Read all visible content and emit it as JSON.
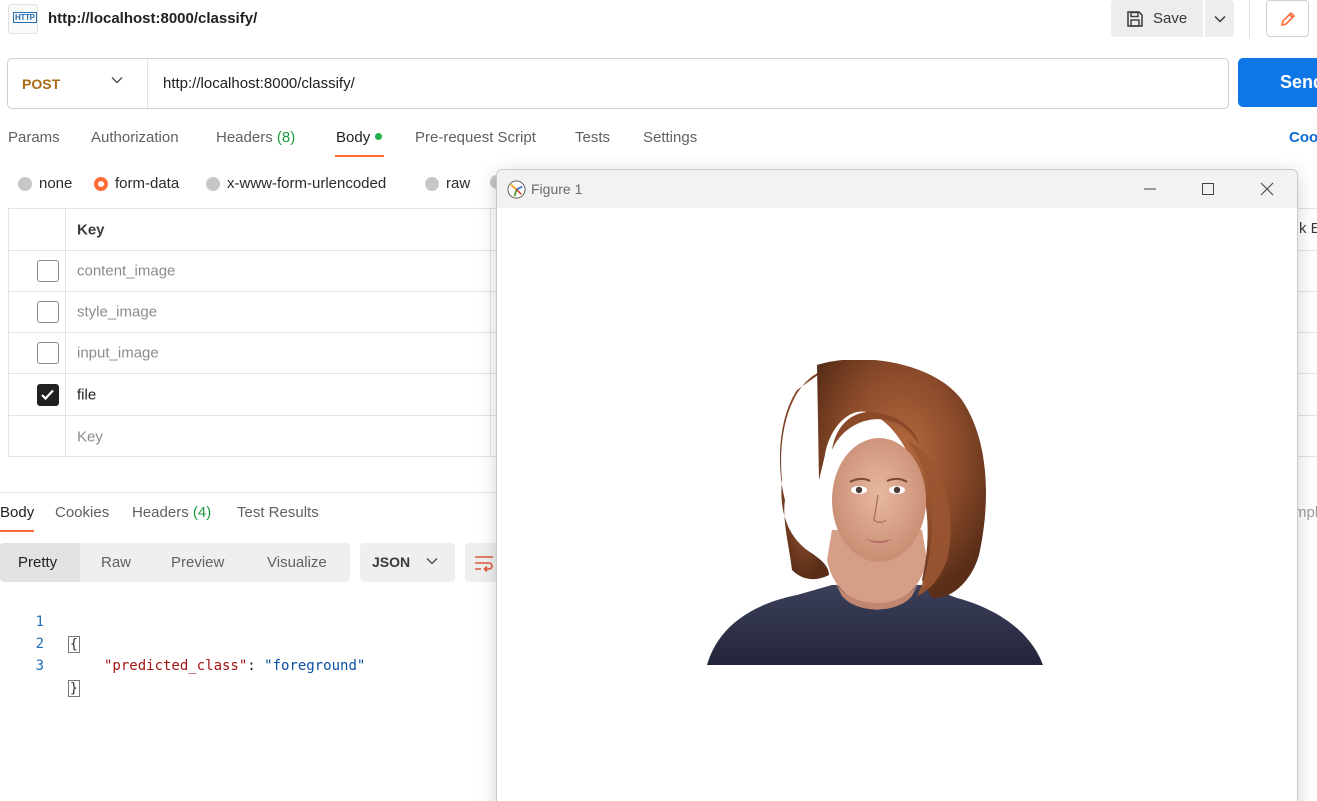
{
  "top_bar": {
    "icon_label": "HTTP",
    "title": "http://localhost:8000/classify/",
    "save_label": "Save"
  },
  "request": {
    "method": "POST",
    "url": "http://localhost:8000/classify/",
    "send_label": "Send"
  },
  "request_tabs": {
    "params": "Params",
    "authorization": "Authorization",
    "headers": "Headers",
    "headers_count": "(8)",
    "body": "Body",
    "pre_request": "Pre-request Script",
    "tests": "Tests",
    "settings": "Settings",
    "cookies": "Coo"
  },
  "body_types": {
    "none": "none",
    "form_data": "form-data",
    "urlencoded": "x-www-form-urlencoded",
    "raw": "raw",
    "selected": "form-data"
  },
  "form_table": {
    "key_header": "Key",
    "rows": [
      {
        "key": "content_image",
        "checked": false
      },
      {
        "key": "style_image",
        "checked": false
      },
      {
        "key": "input_image",
        "checked": false
      },
      {
        "key": "file",
        "checked": true
      }
    ],
    "new_key_placeholder": "Key",
    "right_header_partial": "k E"
  },
  "response_tabs": {
    "body": "Body",
    "cookies": "Cookies",
    "headers": "Headers",
    "headers_count": "(4)",
    "test_results": "Test Results",
    "right_partial": "mpl"
  },
  "view_toolbar": {
    "pretty": "Pretty",
    "raw": "Raw",
    "preview": "Preview",
    "visualize": "Visualize",
    "format": "JSON"
  },
  "response_body": {
    "line_numbers": [
      "1",
      "2",
      "3"
    ],
    "open_brace": "{",
    "key": "\"predicted_class\"",
    "colon": ": ",
    "value": "\"foreground\"",
    "close_brace": "}"
  },
  "figure_window": {
    "title": "Figure 1"
  },
  "colors": {
    "accent_orange": "#ff6c37",
    "send_blue": "#0e76e6",
    "method_post": "#a76b15",
    "count_green": "#1f9c3f"
  }
}
